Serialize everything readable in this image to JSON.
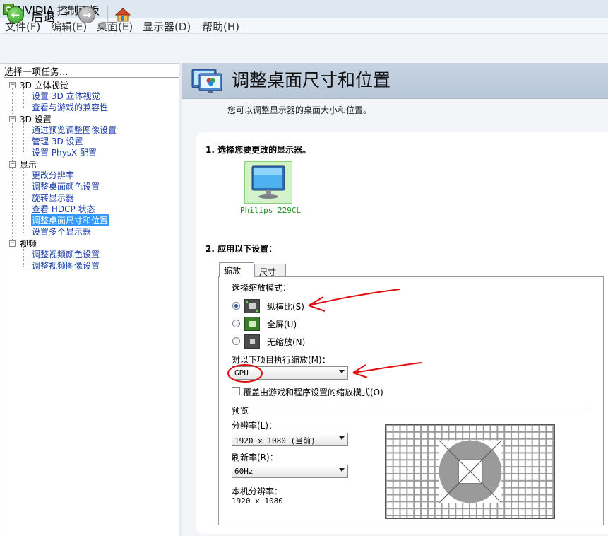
{
  "window": {
    "title": "NVIDIA 控制面板"
  },
  "menu": [
    "文件(F)",
    "编辑(E)",
    "桌面(E)",
    "显示器(D)",
    "帮助(H)"
  ],
  "toolbar": {
    "back_label": "后退",
    "dropdown_glyph": "▾",
    "back_glyph": "←",
    "forward_glyph": "→"
  },
  "sidebar": {
    "task_label": "选择一项任务...",
    "categories": [
      {
        "label": "3D 立体视觉",
        "expander": "−",
        "items": [
          "设置 3D 立体视觉",
          "查看与游戏的兼容性"
        ]
      },
      {
        "label": "3D 设置",
        "expander": "−",
        "items": [
          "通过预览调整图像设置",
          "管理 3D 设置",
          "设置 PhysX 配置"
        ]
      },
      {
        "label": "显示",
        "expander": "−",
        "items": [
          "更改分辨率",
          "调整桌面颜色设置",
          "旋转显示器",
          "查看 HDCP 状态",
          "调整桌面尺寸和位置",
          "设置多个显示器"
        ]
      },
      {
        "label": "视频",
        "expander": "−",
        "items": [
          "调整视频颜色设置",
          "调整视频图像设置"
        ]
      }
    ],
    "selected_item": "调整桌面尺寸和位置"
  },
  "header": {
    "title": "调整桌面尺寸和位置",
    "description": "您可以调整显示器的桌面大小和位置。"
  },
  "step1": {
    "title": "1. 选择您要更改的显示器。",
    "monitor_name": "Philips 229CL"
  },
  "step2": {
    "title": "2. 应用以下设置：",
    "tabs": [
      "缩放",
      "尺寸"
    ],
    "active_tab": "缩放",
    "scaling_mode_label": "选择缩放模式：",
    "modes": [
      {
        "label": "纵横比(S)",
        "selected": true
      },
      {
        "label": "全屏(U)",
        "selected": false
      },
      {
        "label": "无缩放(N)",
        "selected": false
      }
    ],
    "perform_scaling_label": "对以下项目执行缩放(M)：",
    "perform_scaling_value": "GPU",
    "override_label": "覆盖由游戏和程序设置的缩放模式(O)",
    "override_checked": false,
    "preview_label": "预览",
    "resolution_label": "分辨率(L)：",
    "resolution_value": "1920 x 1080 (当前)",
    "refresh_label": "刷新率(R)：",
    "refresh_value": "60Hz",
    "native_label": "本机分辨率：",
    "native_value": "1920 x 1080"
  },
  "colors": {
    "header_band": "#c6d3e2",
    "link": "#1b3ea8",
    "selection": "#3399ff",
    "annotation": "#e01010"
  }
}
